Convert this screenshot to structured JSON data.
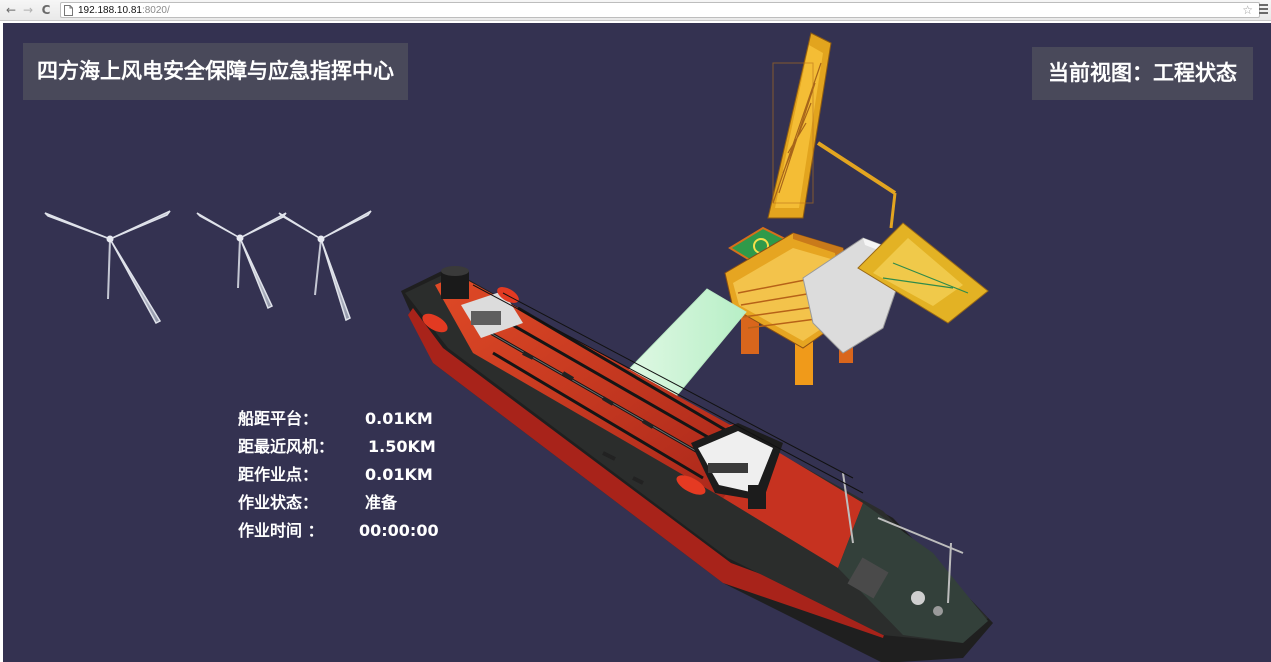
{
  "browser": {
    "back_glyph": "←",
    "forward_glyph": "→",
    "reload_glyph": "C",
    "url_host": "192.188.10.81",
    "url_rest": ":8020/",
    "star_glyph": "☆"
  },
  "header": {
    "title": "四方海上风电安全保障与应急指挥中心",
    "current_view": "当前视图：工程状态"
  },
  "info": {
    "ship_to_platform": {
      "label": "船距平台：",
      "value": "0.01KM"
    },
    "nearest_turbine": {
      "label": "距最近风机：",
      "value": "1.50KM"
    },
    "work_point": {
      "label": "距作业点：",
      "value": "0.01KM"
    },
    "work_status": {
      "label": "作业状态：",
      "value": "准备"
    },
    "work_time": {
      "label": "作业时间 ：",
      "value": "00:00:00"
    }
  },
  "colors": {
    "background": "#343251",
    "panel": "#50505c",
    "ship_deck": "#d23a1e",
    "platform": "#f2b21c",
    "walkway": "#c8f2d0"
  }
}
